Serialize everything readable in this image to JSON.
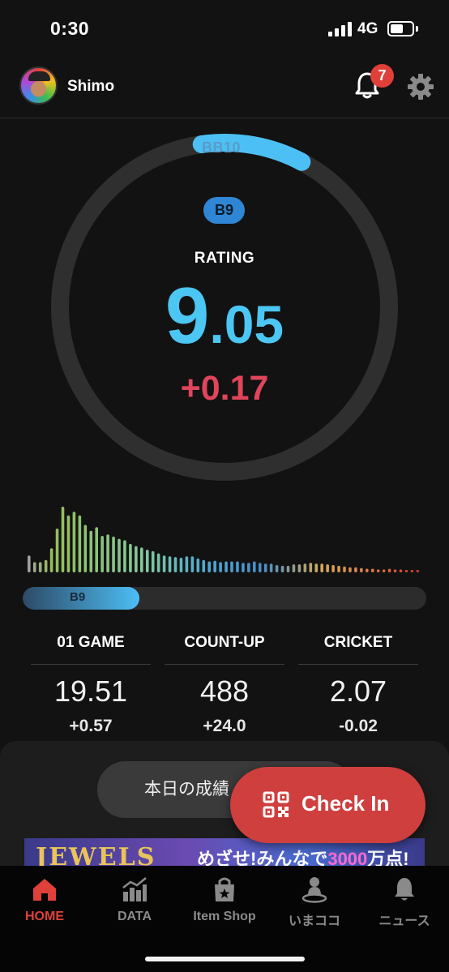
{
  "status_bar": {
    "time": "0:30",
    "network": "4G"
  },
  "header": {
    "username": "Shimo",
    "notification_count": "7"
  },
  "rating": {
    "next_class": "BB10",
    "current_class": "B9",
    "label": "RATING",
    "value_int": "9",
    "value_dec": ".05",
    "diff": "+0.17",
    "ring_progress": 0.1
  },
  "class_progress": {
    "label": "B9",
    "fill_fraction": 0.29
  },
  "histogram": {
    "values": [
      0.23,
      0.14,
      0.14,
      0.17,
      0.33,
      0.6,
      0.9,
      0.78,
      0.83,
      0.78,
      0.65,
      0.57,
      0.62,
      0.5,
      0.52,
      0.49,
      0.46,
      0.44,
      0.39,
      0.36,
      0.34,
      0.31,
      0.29,
      0.26,
      0.23,
      0.22,
      0.21,
      0.2,
      0.22,
      0.22,
      0.19,
      0.17,
      0.15,
      0.16,
      0.14,
      0.15,
      0.15,
      0.15,
      0.13,
      0.13,
      0.15,
      0.13,
      0.12,
      0.12,
      0.1,
      0.09,
      0.09,
      0.11,
      0.11,
      0.12,
      0.13,
      0.12,
      0.12,
      0.11,
      0.1,
      0.09,
      0.08,
      0.07,
      0.07,
      0.06,
      0.05,
      0.05,
      0.04,
      0.04,
      0.05,
      0.04,
      0.04,
      0.03,
      0.03,
      0.03
    ]
  },
  "stats": [
    {
      "title": "01 GAME",
      "value": "19.51",
      "diff": "+0.57"
    },
    {
      "title": "COUNT-UP",
      "value": "488",
      "diff": "+24.0"
    },
    {
      "title": "CRICKET",
      "value": "2.07",
      "diff": "-0.02"
    }
  ],
  "today_button": {
    "label": "本日の成績"
  },
  "banner": {
    "title": "JEWELS",
    "text_a": "めざせ!みんなで",
    "text_num": "3000",
    "text_b": "万点!"
  },
  "checkin": {
    "label": "Check In"
  },
  "tabs": [
    {
      "label": "HOME",
      "icon": "home-icon",
      "active": true
    },
    {
      "label": "DATA",
      "icon": "bar-chart-icon",
      "active": false
    },
    {
      "label": "Item Shop",
      "icon": "shop-bag-icon",
      "active": false
    },
    {
      "label": "いまココ",
      "icon": "location-person-icon",
      "active": false
    },
    {
      "label": "ニュース",
      "icon": "bell-icon",
      "active": false
    }
  ],
  "colors": {
    "accent_red": "#e0403a",
    "rating_blue": "#4cc6f3",
    "diff_red": "#e0455a",
    "checkin_red": "#cf3f3e"
  }
}
